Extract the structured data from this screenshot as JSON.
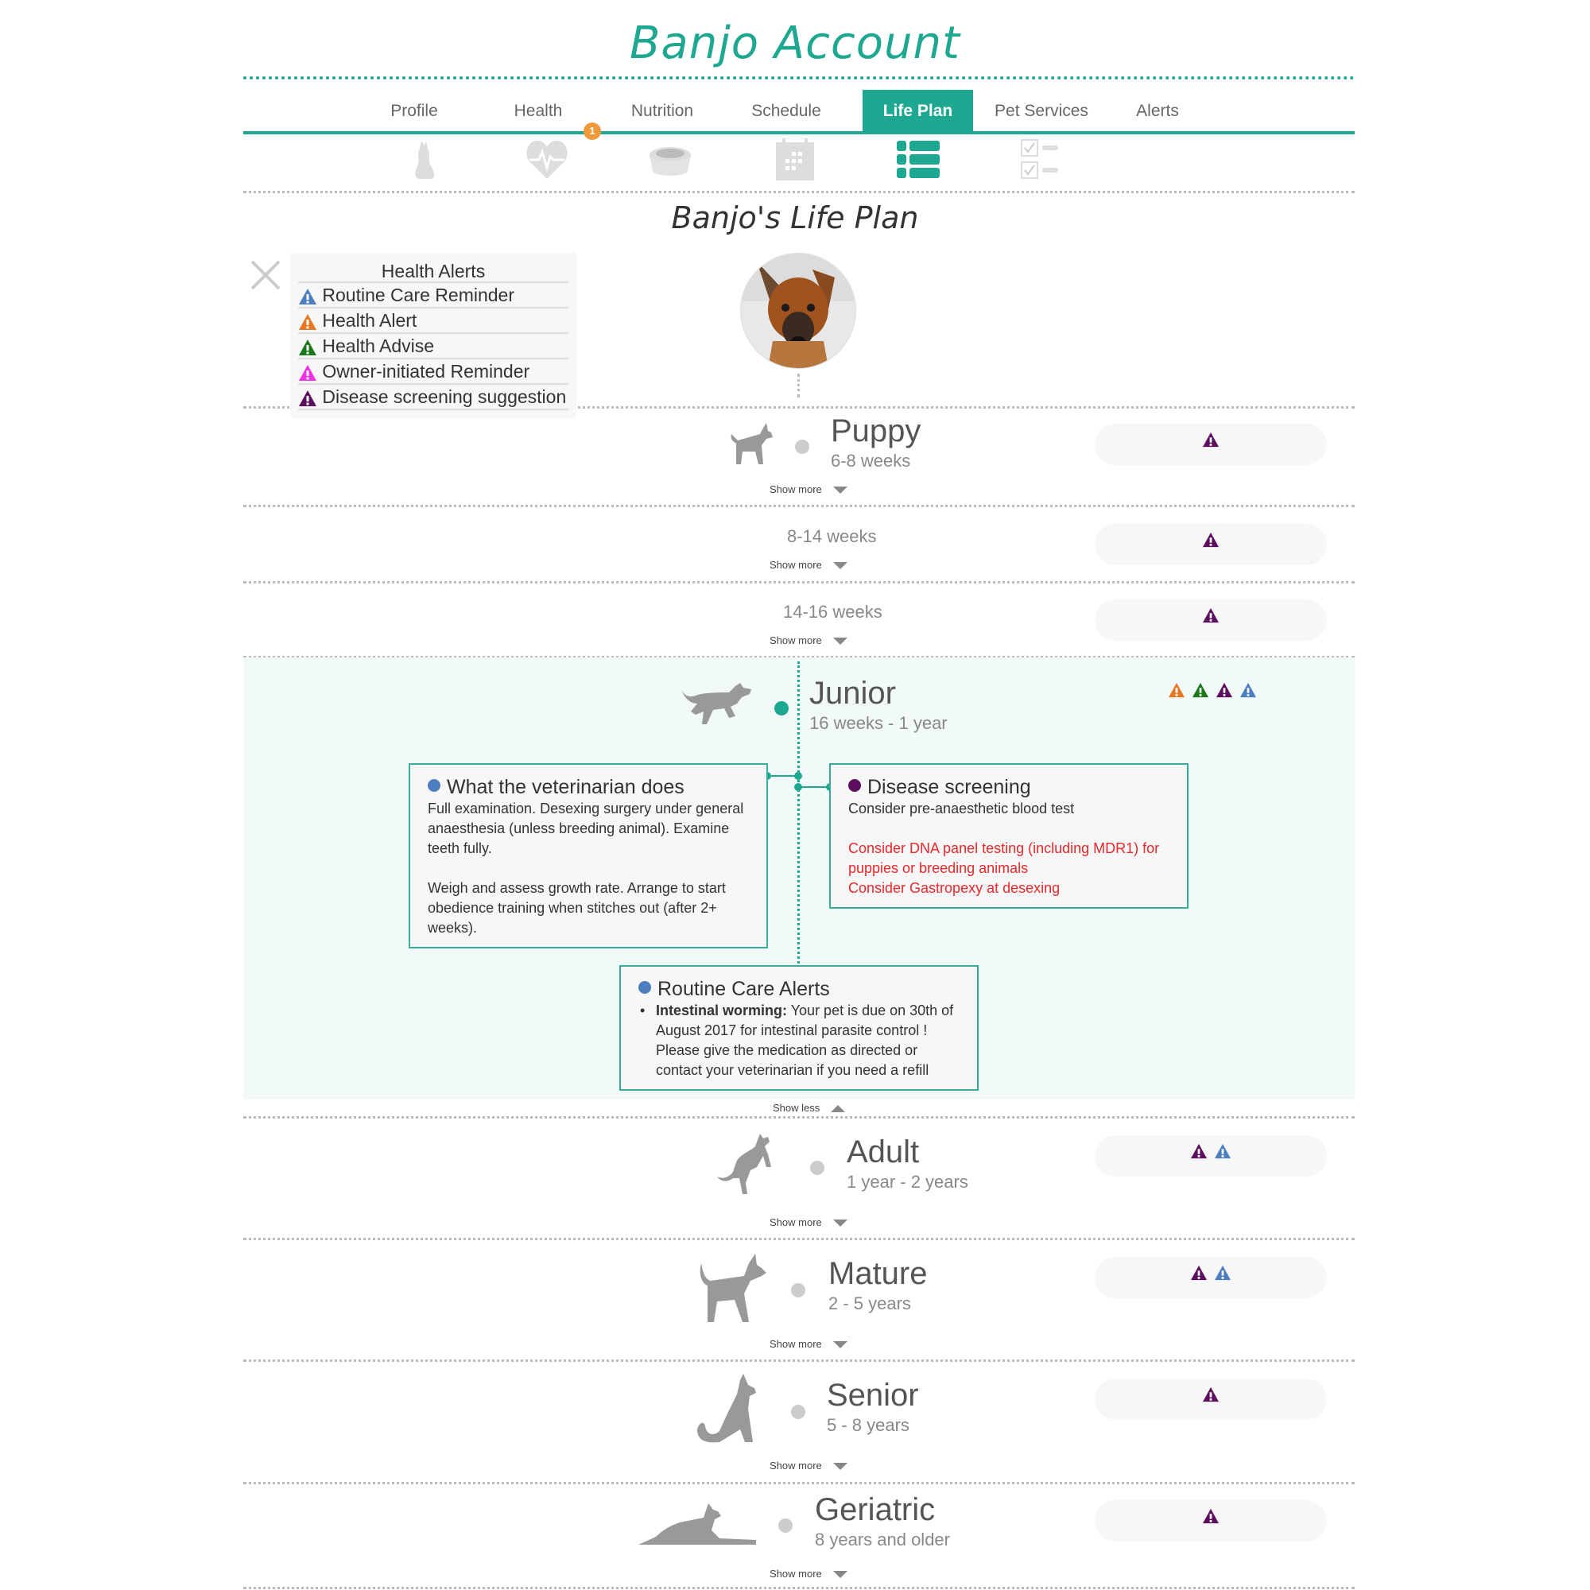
{
  "header": {
    "title_pet": "Banjo",
    "title_rest": "Account"
  },
  "tabs": [
    {
      "label": "Profile",
      "icon": "sitting-cat-icon",
      "active": false
    },
    {
      "label": "Health",
      "icon": "heart-pulse-icon",
      "active": false,
      "badge": "1"
    },
    {
      "label": "Nutrition",
      "icon": "food-bowl-icon",
      "active": false
    },
    {
      "label": "Schedule",
      "icon": "calendar-icon",
      "active": false
    },
    {
      "label": "Life Plan",
      "icon": "list-icon",
      "active": true
    },
    {
      "label": "Pet Services",
      "icon": "checklist-icon",
      "active": false
    },
    {
      "label": "Alerts",
      "icon": "",
      "active": false
    }
  ],
  "page_title": "Banjo's Life Plan",
  "legend": {
    "title": "Health Alerts",
    "items": [
      {
        "label": "Routine Care Reminder",
        "color": "#4d7fc0"
      },
      {
        "label": "Health Alert",
        "color": "#e87722"
      },
      {
        "label": "Health Advise",
        "color": "#1a7a1a"
      },
      {
        "label": "Owner-initiated Reminder",
        "color": "#f032e6"
      },
      {
        "label": "Disease screening suggestion",
        "color": "#5c0f5e"
      }
    ]
  },
  "colors": {
    "accent": "#1fa891",
    "badge": "#f0993a",
    "routine": "#4d7fc0",
    "health_alert": "#e87722",
    "health_advise": "#1a7a1a",
    "owner": "#f032e6",
    "disease": "#5c0f5e",
    "red_text": "#e8282b"
  },
  "stages": [
    {
      "name": "Puppy",
      "range": "6-8 weeks",
      "toggle": "Show more",
      "alerts": [
        "disease"
      ]
    },
    {
      "name": "",
      "range": "8-14 weeks",
      "toggle": "Show more",
      "alerts": [
        "disease"
      ]
    },
    {
      "name": "",
      "range": "14-16 weeks",
      "toggle": "Show more",
      "alerts": [
        "disease"
      ]
    },
    {
      "name": "Junior",
      "range": "16 weeks - 1 year",
      "toggle": "Show less",
      "alerts": [
        "health_alert",
        "health_advise",
        "disease",
        "routine"
      ],
      "expanded": true
    },
    {
      "name": "Adult",
      "range": "1 year - 2 years",
      "toggle": "Show more",
      "alerts": [
        "disease",
        "routine"
      ]
    },
    {
      "name": "Mature",
      "range": "2 - 5 years",
      "toggle": "Show more",
      "alerts": [
        "disease",
        "routine"
      ]
    },
    {
      "name": "Senior",
      "range": "5 - 8 years",
      "toggle": "Show more",
      "alerts": [
        "disease"
      ]
    },
    {
      "name": "Geriatric",
      "range": "8 years and older",
      "toggle": "Show more",
      "alerts": [
        "disease"
      ]
    }
  ],
  "junior": {
    "vet": {
      "title": "What the veterinarian does",
      "p1": "Full examination. Desexing surgery under general anaesthesia (unless breeding animal). Examine teeth fully.",
      "p2": "Weigh and assess growth rate. Arrange to start obedience training when stitches out (after 2+ weeks)."
    },
    "screening": {
      "title": "Disease screening",
      "p1": "Consider pre-anaesthetic blood test",
      "red1": "Consider DNA panel testing (including MDR1) for puppies or breeding animals",
      "red2": "Consider Gastropexy at desexing"
    },
    "routine": {
      "title": "Routine Care Alerts",
      "item_bold": "Intestinal worming:",
      "item_text": " Your pet is due on 30th of August 2017 for intestinal parasite control ! Please give the medication as directed or contact your veterinarian if you need a refill"
    }
  }
}
